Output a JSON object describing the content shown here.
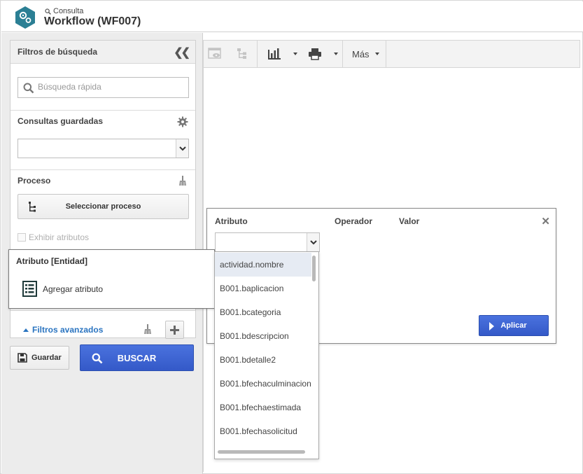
{
  "header": {
    "breadcrumb": "Consulta",
    "title": "Workflow (WF007)"
  },
  "filters": {
    "title": "Filtros de búsqueda",
    "quick_search_placeholder": "Búsqueda rápida",
    "saved_label": "Consultas guardadas",
    "saved_value": "",
    "process_label": "Proceso",
    "select_process": "Seleccionar proceso",
    "show_attributes": "Exhibir atributos",
    "advanced": "Filtros avanzados",
    "save": "Guardar",
    "search": "BUSCAR"
  },
  "attribute_popup": {
    "title": "Atributo [Entidad]",
    "add": "Agregar atributo"
  },
  "toolbar": {
    "more": "Más"
  },
  "dialog": {
    "col_attribute": "Atributo",
    "col_operator": "Operador",
    "col_value": "Valor",
    "apply": "Aplicar",
    "selected_attribute": "",
    "options": [
      "actividad.nombre",
      "B001.baplicacion",
      "B001.bcategoria",
      "B001.bdescripcion",
      "B001.bdetalle2",
      "B001.bfechaculminacion",
      "B001.bfechaestimada",
      "B001.bfechasolicitud"
    ]
  },
  "colors": {
    "accent_blue": "#3a61d0",
    "logo_teal": "#2b7f94",
    "link_blue": "#2a74c0"
  }
}
